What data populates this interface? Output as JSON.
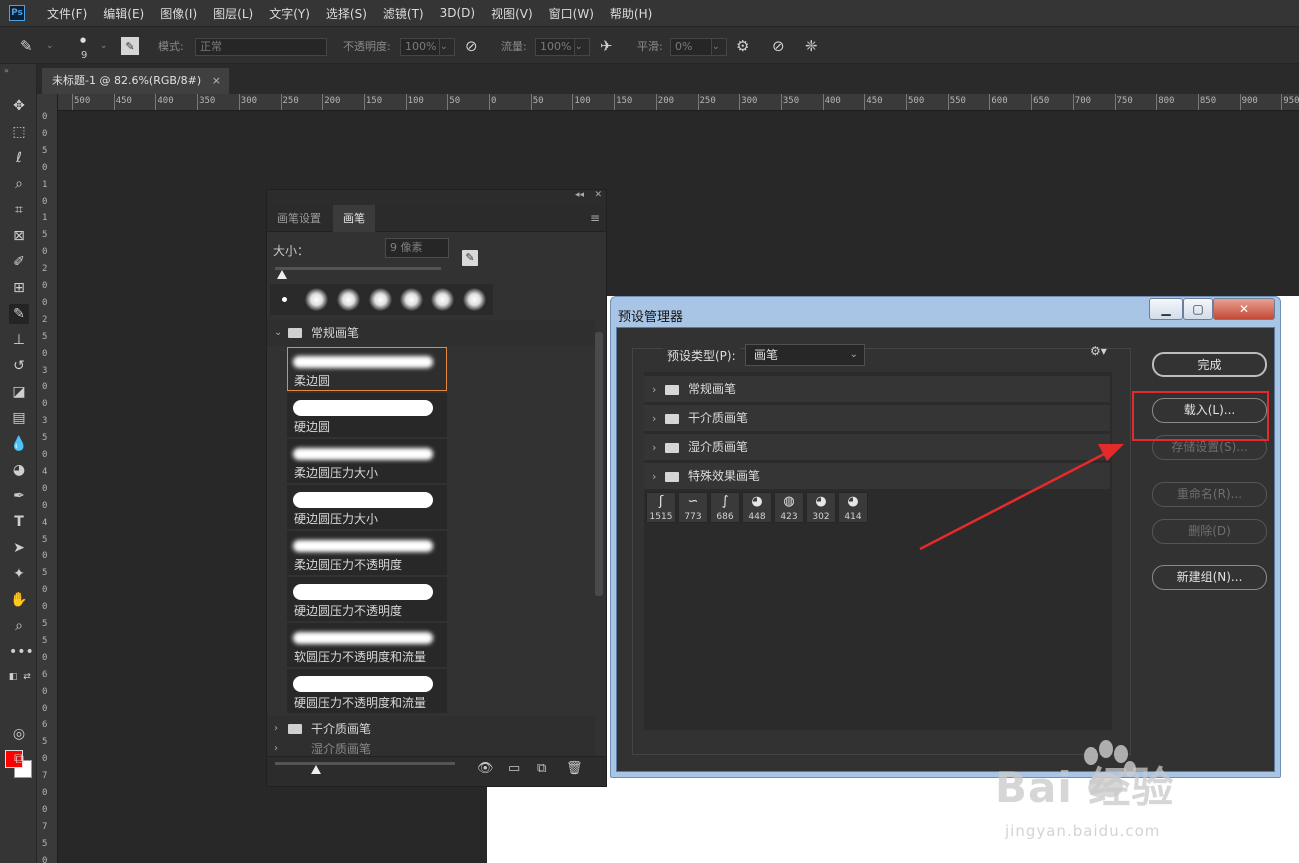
{
  "app": {
    "logo": "Ps",
    "menu": [
      "文件(F)",
      "编辑(E)",
      "图像(I)",
      "图层(L)",
      "文字(Y)",
      "选择(S)",
      "滤镜(T)",
      "3D(D)",
      "视图(V)",
      "窗口(W)",
      "帮助(H)"
    ]
  },
  "options": {
    "brush_size": "9",
    "mode_label": "模式:",
    "mode_value": "正常",
    "opacity_label": "不透明度:",
    "opacity_value": "100%",
    "flow_label": "流量:",
    "flow_value": "100%",
    "smooth_label": "平滑:",
    "smooth_value": "0%"
  },
  "document": {
    "tab_title": "未标题-1 @ 82.6%(RGB/8#)",
    "tab_close": "×"
  },
  "ruler": {
    "h_ticks": [
      "500",
      "450",
      "400",
      "350",
      "300",
      "250",
      "200",
      "150",
      "100",
      "50",
      "0",
      "50",
      "100",
      "150",
      "200",
      "250",
      "300",
      "350",
      "400",
      "450",
      "500",
      "550",
      "600",
      "650",
      "700",
      "750",
      "800",
      "850",
      "900",
      "950"
    ],
    "v_ticks": [
      "0",
      "0",
      "5",
      "0",
      "1",
      "0",
      "1",
      "5",
      "0",
      "2",
      "0",
      "0",
      "2",
      "5",
      "0",
      "3",
      "0",
      "0",
      "3",
      "5",
      "0",
      "4",
      "0",
      "0",
      "4",
      "5",
      "0",
      "5",
      "0",
      "0",
      "5",
      "5",
      "0",
      "6",
      "0",
      "0",
      "6",
      "5",
      "0",
      "7",
      "0",
      "0",
      "7",
      "5",
      "0"
    ]
  },
  "toolbar": {
    "tools": [
      "move-icon",
      "marquee-icon",
      "lasso-icon",
      "quick-select-icon",
      "crop-icon",
      "frame-icon",
      "eyedropper-icon",
      "healing-icon",
      "brush-icon",
      "stamp-icon",
      "history-brush-icon",
      "eraser-icon",
      "gradient-icon",
      "blur-icon",
      "dodge-icon",
      "pen-icon",
      "type-icon",
      "path-select-icon",
      "shape-icon",
      "hand-icon",
      "zoom-icon",
      "more-icon"
    ],
    "foreground_color": "#ff0000",
    "background_color": "#ffffff"
  },
  "brush_panel": {
    "tabs": [
      "画笔设置",
      "画笔"
    ],
    "active_tab": "画笔",
    "size_label": "大小：",
    "size_value": "9 像素",
    "groups": [
      "常规画笔",
      "干介质画笔",
      "湿介质画笔"
    ],
    "brushes": [
      "柔边圆",
      "硬边圆",
      "柔边圆压力大小",
      "硬边圆压力大小",
      "柔边圆压力不透明度",
      "硬边圆压力不透明度",
      "软圆压力不透明度和流量",
      "硬圆压力不透明度和流量"
    ],
    "selected_brush": "柔边圆"
  },
  "preset_manager": {
    "title": "预设管理器",
    "type_label": "预设类型(P):",
    "type_value": "画笔",
    "groups": [
      "常规画笔",
      "干介质画笔",
      "湿介质画笔",
      "特殊效果画笔"
    ],
    "thumbs": [
      "1515",
      "773",
      "686",
      "448",
      "423",
      "302",
      "414"
    ],
    "buttons": {
      "done": "完成",
      "load": "载入(L)...",
      "save": "存储设置(S)...",
      "rename": "重命名(R)...",
      "delete": "删除(D)",
      "new_group": "新建组(N)..."
    },
    "highlight_color": "#e42a2a"
  },
  "watermark": {
    "brand": "Bai  经验",
    "url": "jingyan.baidu.com"
  }
}
